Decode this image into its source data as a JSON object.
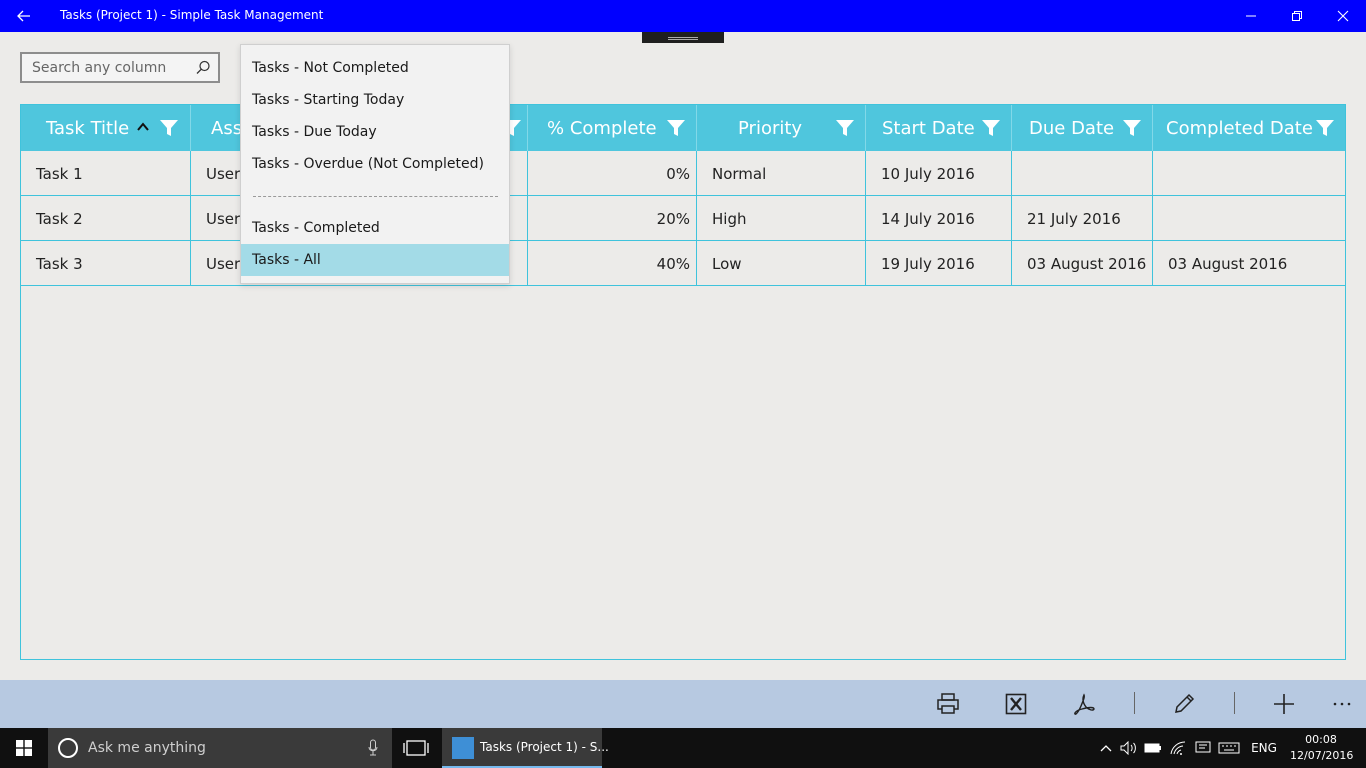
{
  "window": {
    "title": "Tasks (Project 1) - Simple Task Management"
  },
  "search": {
    "placeholder": "Search any column"
  },
  "grid": {
    "columns": [
      {
        "label": "Task Title"
      },
      {
        "label": "Ass"
      },
      {
        "label": ""
      },
      {
        "label": "% Complete"
      },
      {
        "label": "Priority"
      },
      {
        "label": "Start Date"
      },
      {
        "label": "Due Date"
      },
      {
        "label": "Completed Date"
      }
    ],
    "rows": [
      {
        "title": "Task 1",
        "assigned": "User",
        "complete": "0%",
        "priority": "Normal",
        "start": "10 July 2016",
        "due": "",
        "completed": ""
      },
      {
        "title": "Task 2",
        "assigned": "User",
        "complete": "20%",
        "priority": "High",
        "start": "14 July 2016",
        "due": "21 July 2016",
        "completed": ""
      },
      {
        "title": "Task 3",
        "assigned": "User",
        "complete": "40%",
        "priority": "Low",
        "start": "19 July 2016",
        "due": "03 August 2016",
        "completed": "03 August 2016"
      }
    ]
  },
  "dropdown": {
    "items": [
      "Tasks - Not Completed",
      "Tasks - Starting Today",
      "Tasks - Due Today",
      "Tasks - Overdue (Not Completed)",
      "Tasks - Completed",
      "Tasks - All"
    ],
    "selected": "Tasks - All"
  },
  "taskbar": {
    "search_text": "Ask me anything",
    "app_label": "Tasks (Project 1) - S...",
    "language": "ENG",
    "time": "00:08",
    "date": "12/07/2016"
  },
  "colors": {
    "titlebar": "#0000ff",
    "header": "#4fc6dd",
    "selected_item": "#a3dbe7",
    "command_bar": "#b7c9e1"
  }
}
